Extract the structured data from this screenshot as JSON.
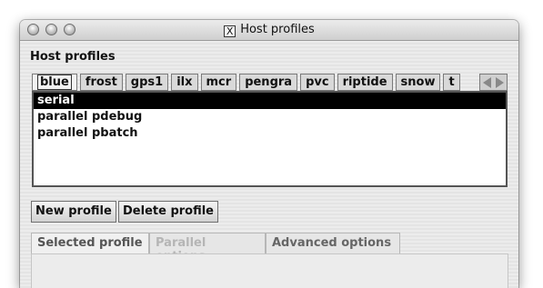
{
  "window": {
    "title": "Host profiles"
  },
  "heading": "Host profiles",
  "host_tabs": [
    {
      "label": "blue"
    },
    {
      "label": "frost"
    },
    {
      "label": "gps1"
    },
    {
      "label": "ilx"
    },
    {
      "label": "mcr"
    },
    {
      "label": "pengra"
    },
    {
      "label": "pvc"
    },
    {
      "label": "riptide"
    },
    {
      "label": "snow"
    },
    {
      "label": "t"
    }
  ],
  "active_host_tab": "blue",
  "profiles": [
    {
      "label": "serial"
    },
    {
      "label": "parallel pdebug"
    },
    {
      "label": "parallel pbatch"
    }
  ],
  "selected_profile": "serial",
  "buttons": {
    "new_profile": "New profile",
    "delete_profile": "Delete profile"
  },
  "bottom_tabs": [
    {
      "label": "Selected profile"
    },
    {
      "label": "Parallel options"
    },
    {
      "label": "Advanced options"
    }
  ],
  "icons": {
    "window": "x11-icon",
    "scroll_left": "triangle-left-icon",
    "scroll_right": "triangle-right-icon"
  }
}
